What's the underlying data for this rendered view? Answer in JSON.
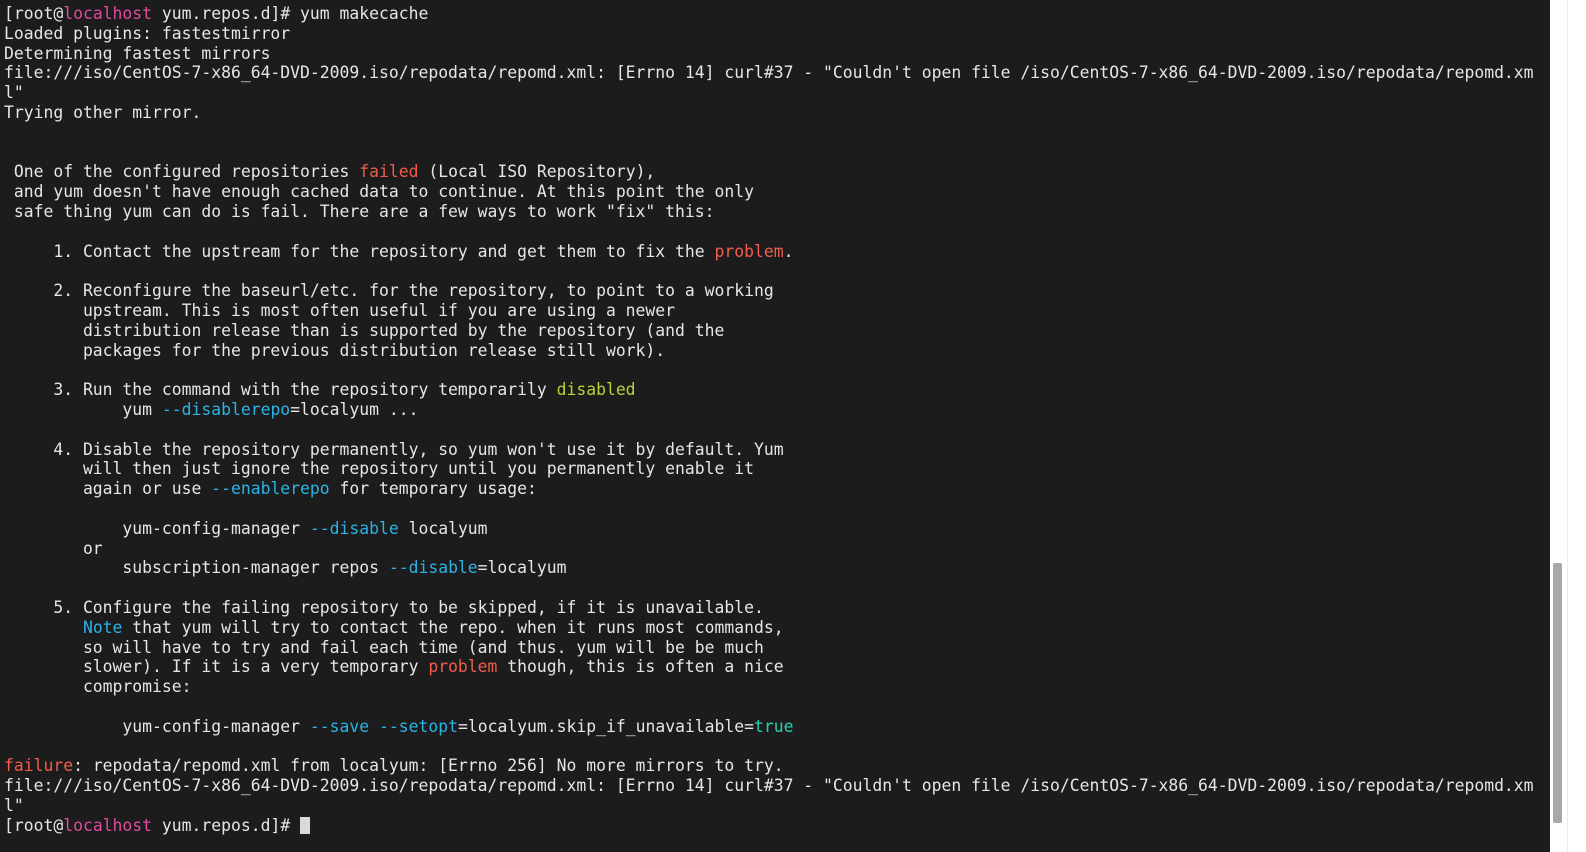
{
  "terminal": {
    "prompt": {
      "open": "[",
      "user": "root",
      "at": "@",
      "host": "localhost",
      "dir": " yum.repos.d]# ",
      "command": "yum makecache"
    },
    "lines": [
      [
        {
          "t": "[root@",
          "c": ""
        },
        {
          "t": "localhost",
          "c": "host"
        },
        {
          "t": " yum.repos.d]# yum makecache",
          "c": ""
        }
      ],
      [
        {
          "t": "Loaded plugins: fastestmirror",
          "c": ""
        }
      ],
      [
        {
          "t": "Determining fastest mirrors",
          "c": ""
        }
      ],
      [
        {
          "t": "file:///iso/CentOS-7-x86_64-DVD-2009.iso/repodata/repomd.xml: [Errno 14] curl#37 - \"Couldn't open file /iso/CentOS-7-x86_64-DVD-2009.iso/repodata/repomd.xm",
          "c": ""
        }
      ],
      [
        {
          "t": "l\"",
          "c": ""
        }
      ],
      [
        {
          "t": "Trying other mirror.",
          "c": ""
        }
      ],
      [
        {
          "t": "",
          "c": ""
        }
      ],
      [
        {
          "t": "",
          "c": ""
        }
      ],
      [
        {
          "t": " One of the configured repositories ",
          "c": ""
        },
        {
          "t": "failed",
          "c": "red"
        },
        {
          "t": " (Local ISO Repository),",
          "c": ""
        }
      ],
      [
        {
          "t": " and yum doesn't have enough cached data to continue. At this point the only",
          "c": ""
        }
      ],
      [
        {
          "t": " safe thing yum can do is fail. There are a few ways to work \"fix\" this:",
          "c": ""
        }
      ],
      [
        {
          "t": "",
          "c": ""
        }
      ],
      [
        {
          "t": "     1. Contact the upstream for the repository and get them to fix the ",
          "c": ""
        },
        {
          "t": "problem",
          "c": "red"
        },
        {
          "t": ".",
          "c": ""
        }
      ],
      [
        {
          "t": "",
          "c": ""
        }
      ],
      [
        {
          "t": "     2. Reconfigure the baseurl/etc. for the repository, to point to a working",
          "c": ""
        }
      ],
      [
        {
          "t": "        upstream. This is most often useful if you are using a newer",
          "c": ""
        }
      ],
      [
        {
          "t": "        distribution release than is supported by the repository (and the",
          "c": ""
        }
      ],
      [
        {
          "t": "        packages for the previous distribution release still work).",
          "c": ""
        }
      ],
      [
        {
          "t": "",
          "c": ""
        }
      ],
      [
        {
          "t": "     3. Run the command with the repository temporarily ",
          "c": ""
        },
        {
          "t": "disabled",
          "c": "yellow"
        }
      ],
      [
        {
          "t": "            yum ",
          "c": ""
        },
        {
          "t": "--disablerepo",
          "c": "cyan"
        },
        {
          "t": "=localyum ...",
          "c": ""
        }
      ],
      [
        {
          "t": "",
          "c": ""
        }
      ],
      [
        {
          "t": "     4. Disable the repository permanently, so yum won't use it by default. Yum",
          "c": ""
        }
      ],
      [
        {
          "t": "        will then just ignore the repository until you permanently enable it",
          "c": ""
        }
      ],
      [
        {
          "t": "        again or use ",
          "c": ""
        },
        {
          "t": "--enablerepo",
          "c": "cyan"
        },
        {
          "t": " for temporary usage:",
          "c": ""
        }
      ],
      [
        {
          "t": "",
          "c": ""
        }
      ],
      [
        {
          "t": "            yum-config-manager ",
          "c": ""
        },
        {
          "t": "--disable",
          "c": "cyan"
        },
        {
          "t": " localyum",
          "c": ""
        }
      ],
      [
        {
          "t": "        or",
          "c": ""
        }
      ],
      [
        {
          "t": "            subscription-manager repos ",
          "c": ""
        },
        {
          "t": "--disable",
          "c": "cyan"
        },
        {
          "t": "=localyum",
          "c": ""
        }
      ],
      [
        {
          "t": "",
          "c": ""
        }
      ],
      [
        {
          "t": "     5. Configure the failing repository to be skipped, if it is unavailable.",
          "c": ""
        }
      ],
      [
        {
          "t": "        ",
          "c": ""
        },
        {
          "t": "Note",
          "c": "cyan"
        },
        {
          "t": " that yum will try to contact the repo. when it runs most commands,",
          "c": ""
        }
      ],
      [
        {
          "t": "        so will have to try and fail each time (and thus. yum will be be much",
          "c": ""
        }
      ],
      [
        {
          "t": "        slower). If it is a very temporary ",
          "c": ""
        },
        {
          "t": "problem",
          "c": "red"
        },
        {
          "t": " though, this is often a nice",
          "c": ""
        }
      ],
      [
        {
          "t": "        compromise:",
          "c": ""
        }
      ],
      [
        {
          "t": "",
          "c": ""
        }
      ],
      [
        {
          "t": "            yum-config-manager ",
          "c": ""
        },
        {
          "t": "--save",
          "c": "cyan"
        },
        {
          "t": " ",
          "c": ""
        },
        {
          "t": "--setopt",
          "c": "cyan"
        },
        {
          "t": "=localyum.skip_if_unavailable=",
          "c": ""
        },
        {
          "t": "true",
          "c": "teal"
        }
      ],
      [
        {
          "t": "",
          "c": ""
        }
      ],
      [
        {
          "t": "failure",
          "c": "red"
        },
        {
          "t": ": repodata/repomd.xml from localyum: [Errno 256] No more mirrors to try.",
          "c": ""
        }
      ],
      [
        {
          "t": "file:///iso/CentOS-7-x86_64-DVD-2009.iso/repodata/repomd.xml: [Errno 14] curl#37 - \"Couldn't open file /iso/CentOS-7-x86_64-DVD-2009.iso/repodata/repomd.xm",
          "c": ""
        }
      ],
      [
        {
          "t": "l\"",
          "c": ""
        }
      ],
      [
        {
          "t": "[root@",
          "c": ""
        },
        {
          "t": "localhost",
          "c": "host"
        },
        {
          "t": " yum.repos.d]# ",
          "c": ""
        },
        {
          "t": "",
          "c": "cursor"
        }
      ]
    ],
    "colors": {
      "background": "#1c1c1c",
      "foreground": "#e6e6e6",
      "host": "#e04aa0",
      "red": "#f25d4b",
      "yellow": "#b8d334",
      "cyan": "#2bb3e6",
      "teal": "#22d3b3"
    }
  },
  "scrollbar": {
    "position": "bottom"
  }
}
